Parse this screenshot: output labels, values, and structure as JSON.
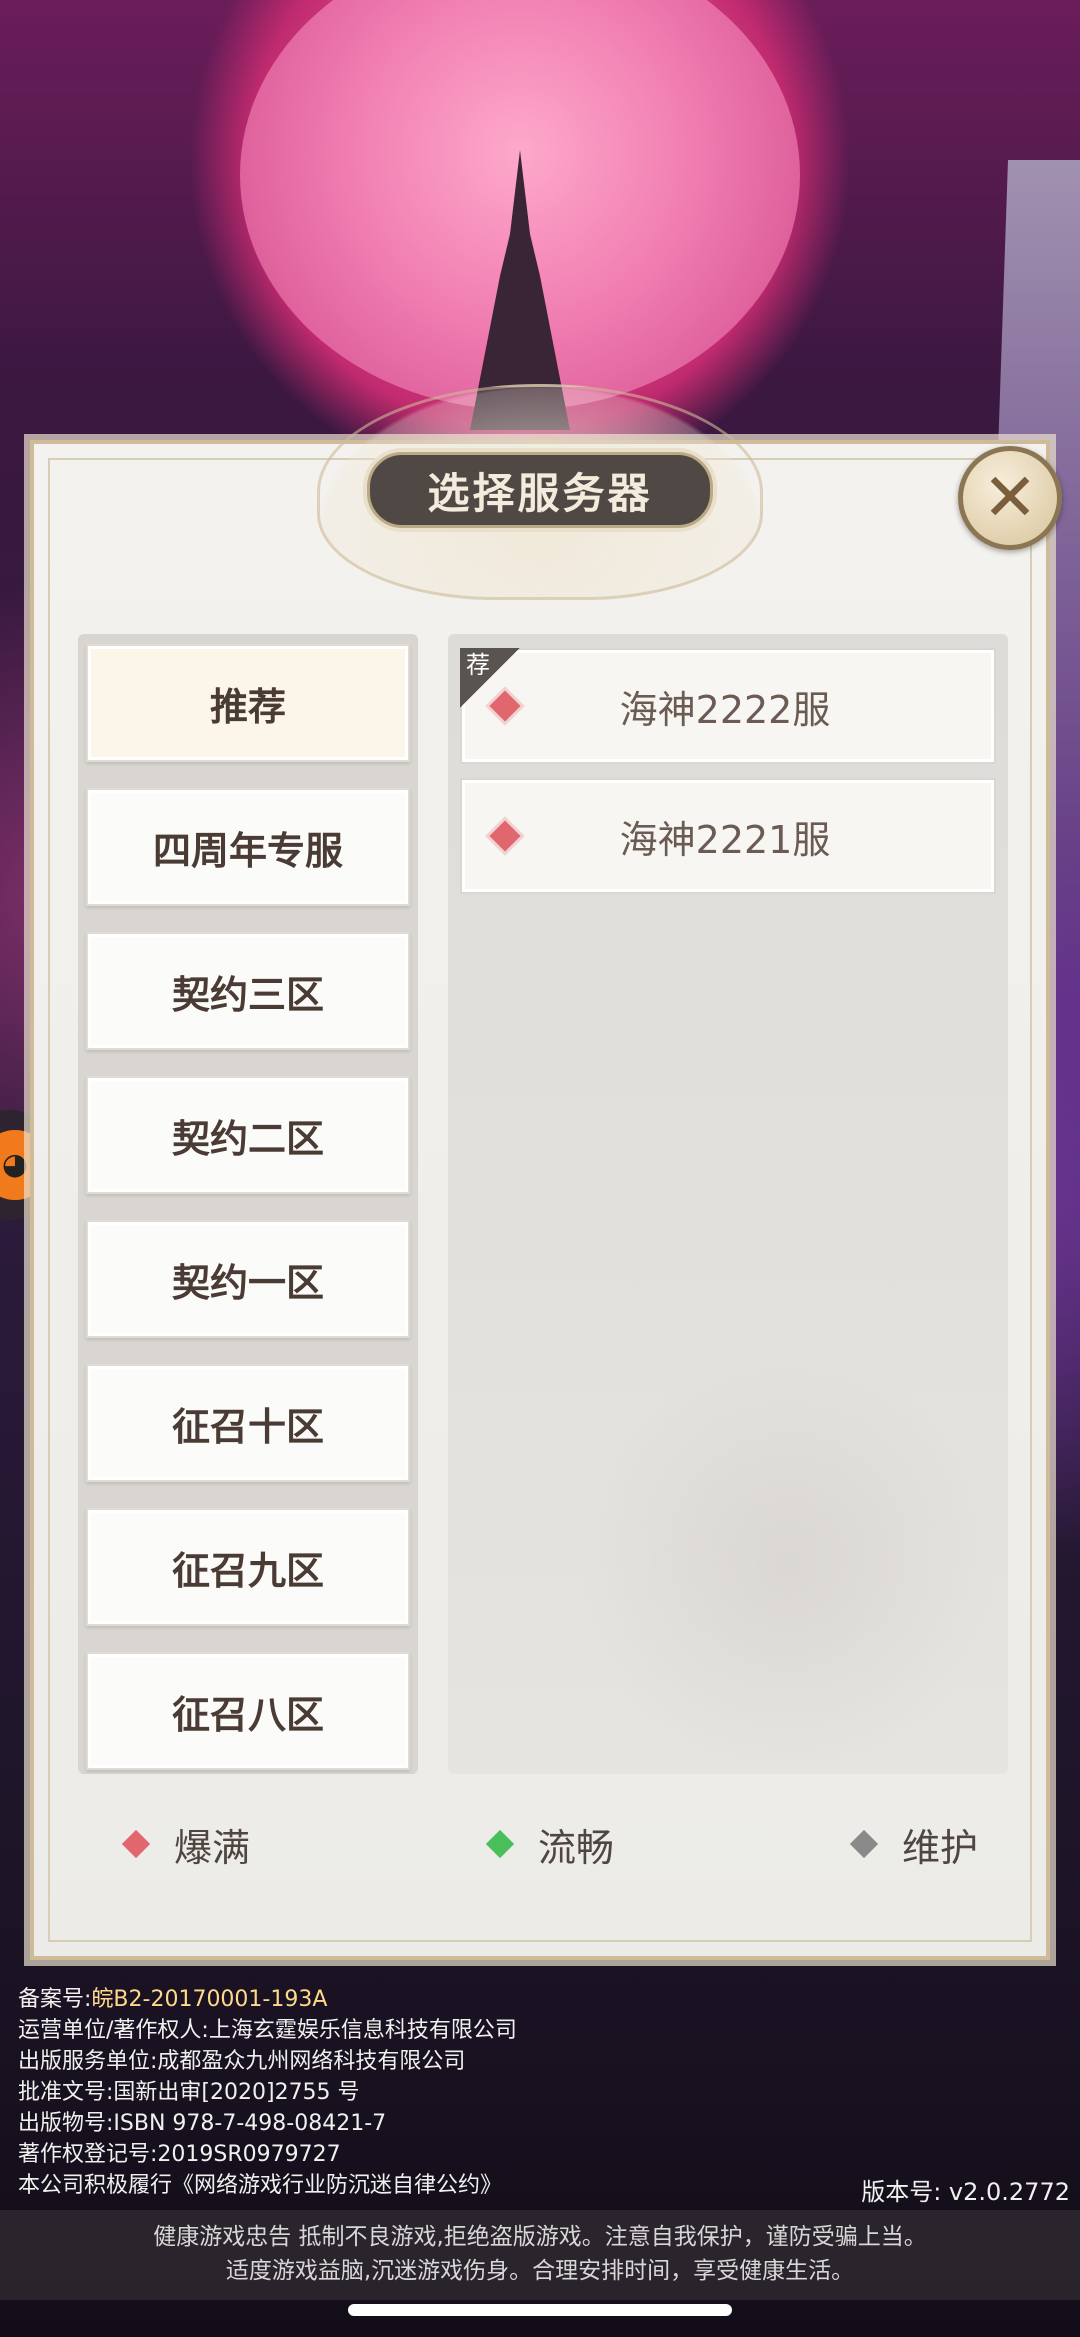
{
  "dialog": {
    "title": "选择服务器",
    "close_icon": "close-icon"
  },
  "groups": [
    {
      "label": "推荐",
      "selected": true
    },
    {
      "label": "四周年专服",
      "selected": false
    },
    {
      "label": "契约三区",
      "selected": false
    },
    {
      "label": "契约二区",
      "selected": false
    },
    {
      "label": "契约一区",
      "selected": false
    },
    {
      "label": "征召十区",
      "selected": false
    },
    {
      "label": "征召九区",
      "selected": false
    },
    {
      "label": "征召八区",
      "selected": false
    }
  ],
  "servers": [
    {
      "name": "海神2222服",
      "status": "爆满",
      "tag": "荐"
    },
    {
      "name": "海神2221服",
      "status": "爆满",
      "tag": ""
    }
  ],
  "legend": [
    {
      "label": "爆满",
      "color": "#e0676d"
    },
    {
      "label": "流畅",
      "color": "#4bbf5a"
    },
    {
      "label": "维护",
      "color": "#8a8a8a"
    }
  ],
  "footer": {
    "icp_label": "备案号:",
    "icp_value": "皖B2-20170001-193A",
    "operator": "运营单位/著作权人:上海玄霆娱乐信息科技有限公司",
    "publisher": "出版服务单位:成都盈众九州网络科技有限公司",
    "approval": "批准文号:国新出审[2020]2755 号",
    "isbn": "出版物号:ISBN 978-7-498-08421-7",
    "copyright": "著作权登记号:2019SR0979727",
    "pledge": "本公司积极履行《网络游戏行业防沉迷自律公约》",
    "version": "版本号: v2.0.2772",
    "health_line1": "健康游戏忠告   抵制不良游戏,拒绝盗版游戏。注意自我保护，谨防受骗上当。",
    "health_line2": "适度游戏益脑,沉迷游戏伤身。合理安排时间，享受健康生活。"
  }
}
